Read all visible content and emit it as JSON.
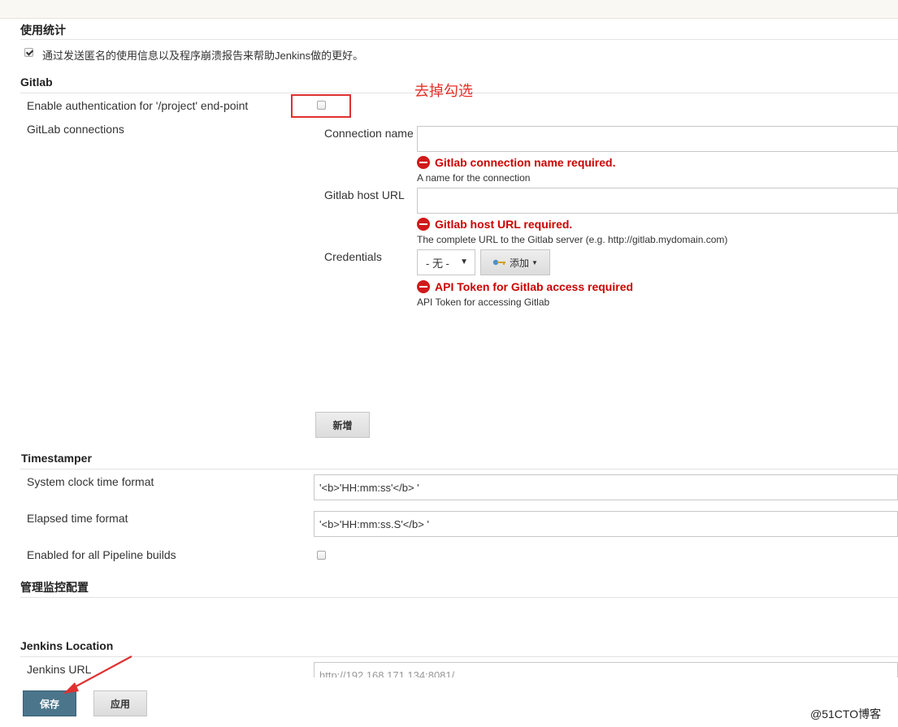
{
  "usage": {
    "title": "使用统计",
    "checkbox_label": "通过发送匿名的使用信息以及程序崩溃报告来帮助Jenkins做的更好。",
    "checked": true
  },
  "gitlab": {
    "title": "Gitlab",
    "enable_auth_label": "Enable authentication for '/project' end-point",
    "connections_label": "GitLab connections",
    "connection_name_label": "Connection name",
    "connection_name_value": "",
    "connection_name_error": "Gitlab connection name required.",
    "connection_name_help": "A name for the connection",
    "host_url_label": "Gitlab host URL",
    "host_url_value": "",
    "host_url_error": "Gitlab host URL required.",
    "host_url_help": "The complete URL to the Gitlab server (e.g. http://gitlab.mydomain.com)",
    "credentials_label": "Credentials",
    "credentials_selected": "- 无 -",
    "add_button": "添加",
    "credentials_error": "API Token for Gitlab access required",
    "credentials_help": "API Token for accessing Gitlab",
    "new_button": "新增"
  },
  "annotation": {
    "text": "去掉勾选",
    "color": "#e8302a"
  },
  "timestamper": {
    "title": "Timestamper",
    "system_clock_label": "System clock time format",
    "system_clock_value": "'<b>'HH:mm:ss'</b> '",
    "elapsed_label": "Elapsed time format",
    "elapsed_value": "'<b>'HH:mm:ss.S'</b> '",
    "pipeline_label": "Enabled for all Pipeline builds"
  },
  "monitor": {
    "title": "管理监控配置"
  },
  "location": {
    "title": "Jenkins Location",
    "url_label": "Jenkins URL",
    "url_value": "http://192.168.171.134:8081/"
  },
  "footer": {
    "save_button": "保存",
    "apply_button": "应用"
  },
  "watermark": "@51CTO博客",
  "colors": {
    "primary_button": "#4b758b",
    "error": "#cc0000"
  }
}
